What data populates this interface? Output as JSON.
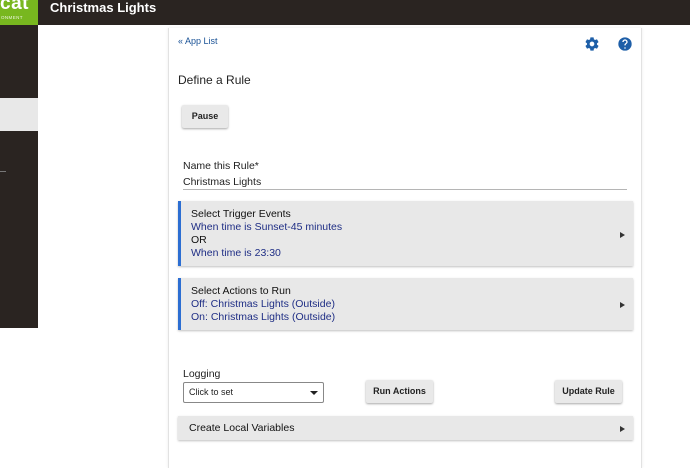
{
  "header": {
    "logo_text": "cat",
    "logo_sub": "ONMENT",
    "title": "Christmas Lights",
    "brand_color": "#78b71f",
    "bar_color": "#2a2421"
  },
  "nav": {
    "app_list_link": "« App List"
  },
  "page": {
    "title": "Define a Rule"
  },
  "buttons": {
    "pause": "Pause",
    "run_actions": "Run Actions",
    "update_rule": "Update Rule"
  },
  "rule_name": {
    "label": "Name this Rule*",
    "value": "Christmas Lights"
  },
  "triggers": {
    "title": "Select Trigger Events",
    "line1": "When time is Sunset-45 minutes",
    "connector": "OR",
    "line2": "When time is 23:30"
  },
  "actions": {
    "title": "Select Actions to Run",
    "line1": "Off: Christmas Lights (Outside)",
    "line2": "On: Christmas Lights (Outside)"
  },
  "logging": {
    "label": "Logging",
    "selected": "Click to set"
  },
  "local_variables": {
    "title": "Create Local Variables"
  },
  "icons": {
    "settings": "gear-icon",
    "help": "help-icon",
    "expand": "chevron-right-icon",
    "dropdown": "chevron-down-icon"
  },
  "colors": {
    "accent": "#2c6ed2",
    "link": "#1a5296",
    "value_text": "#1f2e85"
  }
}
